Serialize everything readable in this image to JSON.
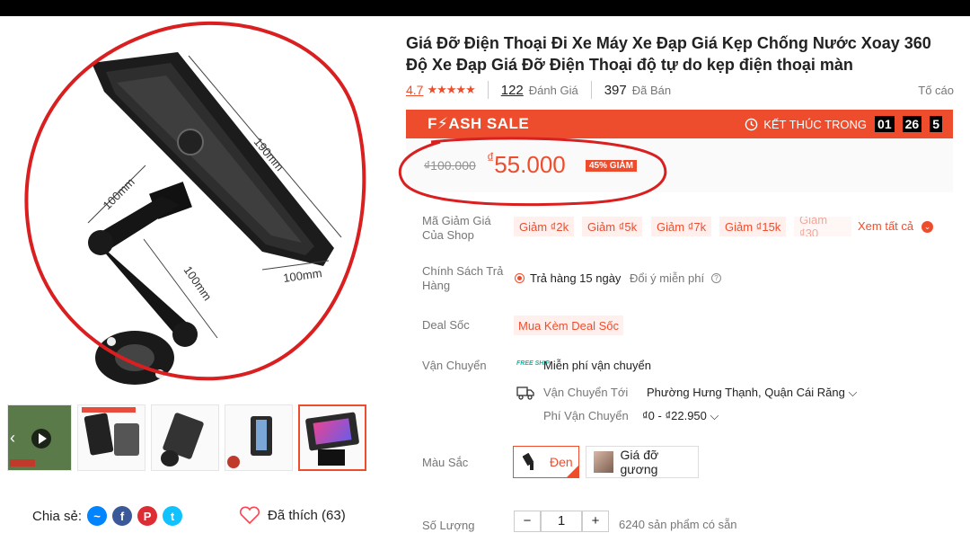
{
  "product": {
    "title": "Giá Đỡ Điện Thoại Đi Xe Máy Xe Đạp Giá Kẹp Chống Nước Xoay 360 Độ Xe Đạp Giá Đỡ Điện Thoại độ tự do kẹp điện thoại màn",
    "rating": "4.7",
    "stars": "★★★★★",
    "reviews_count": "122",
    "reviews_label": "Đánh Giá",
    "sold_count": "397",
    "sold_label": "Đã Bán",
    "report_label": "Tố cáo"
  },
  "image": {
    "dim_190": "190mm",
    "dim_100_a": "100mm",
    "dim_100_b": "100mm",
    "dim_100_c": "100mm"
  },
  "flash_sale": {
    "logo": "F⚡ASH SALE",
    "ends_label": "KẾT THÚC TRONG",
    "hours": "01",
    "minutes": "26",
    "seconds": "5"
  },
  "price": {
    "old": "₫100.000",
    "currency": "₫",
    "new": "55.000",
    "discount": "45% GIẢM"
  },
  "vouchers": {
    "label": "Mã Giảm Giá Của Shop",
    "items": [
      "Giảm ₫2k",
      "Giảm ₫5k",
      "Giảm ₫7k",
      "Giảm ₫15k",
      "Giảm ₫30"
    ],
    "see_all": "Xem tất cả"
  },
  "return_policy": {
    "label": "Chính Sách Trả Hàng",
    "value": "Trả hàng 15 ngày",
    "note": "Đổi ý miễn phí"
  },
  "deal": {
    "label": "Deal Sốc",
    "value": "Mua Kèm Deal Sốc"
  },
  "shipping": {
    "label": "Vận Chuyển",
    "badge": "FREE SHIP",
    "free_text": "Miễn phí vận chuyển",
    "to_label": "Vận Chuyển Tới",
    "to_value": "Phường Hưng Thạnh, Quận Cái Răng",
    "fee_label": "Phí Vận Chuyển",
    "fee_value": "₫0 - ₫22.950"
  },
  "variants": {
    "label": "Màu Sắc",
    "options": [
      "Đen",
      "Giá đỡ gương"
    ],
    "selected": "Đen"
  },
  "quantity": {
    "label": "Số Lượng",
    "value": "1",
    "available": "6240 sản phẩm có sẵn"
  },
  "share": {
    "label": "Chia sẻ:"
  },
  "liked": {
    "label": "Đã thích (63)"
  },
  "colors": {
    "accent": "#ee4d2d",
    "annotation": "#d91f1f"
  }
}
